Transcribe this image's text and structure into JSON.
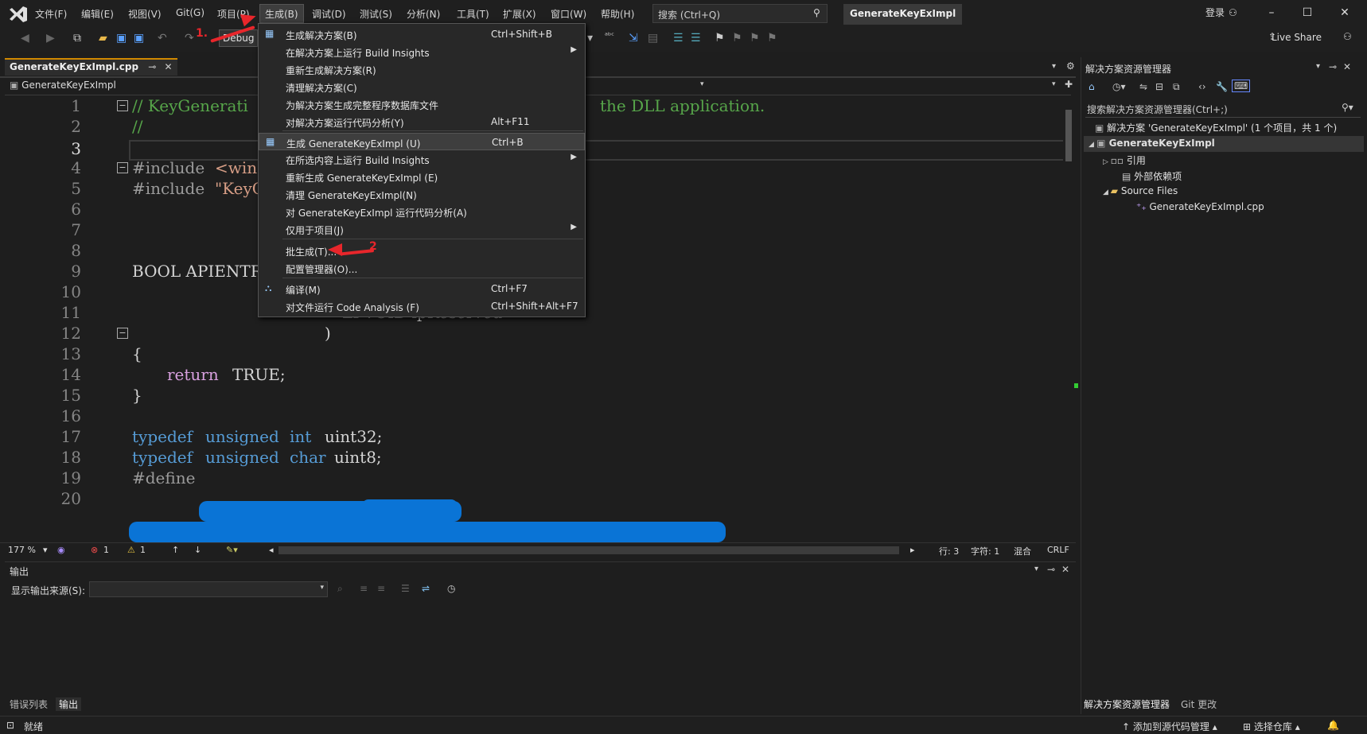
{
  "menubar": {
    "items": [
      "文件(F)",
      "编辑(E)",
      "视图(V)",
      "Git(G)",
      "项目(P)",
      "生成(B)",
      "调试(D)",
      "测试(S)",
      "分析(N)",
      "工具(T)",
      "扩展(X)",
      "窗口(W)",
      "帮助(H)"
    ],
    "search_placeholder": "搜索 (Ctrl+Q)",
    "project_badge": "GenerateKeyExImpl",
    "login": "登录"
  },
  "toolbar": {
    "config": "Debug",
    "live_share": "Live Share"
  },
  "editor": {
    "tab_label": "GenerateKeyExImpl.cpp",
    "nav_file": "GenerateKeyExImpl",
    "line_numbers": [
      "1",
      "2",
      "3",
      "4",
      "5",
      "6",
      "7",
      "8",
      "9",
      "10",
      "11",
      "12",
      "13",
      "14",
      "15",
      "16",
      "17",
      "18",
      "19",
      "20"
    ],
    "lines": {
      "l1a": "// KeyGenerati",
      "l1b": "the DLL application.",
      "l2": "//",
      "l4a": "#include",
      "l4b": "<wind",
      "l5a": "#include",
      "l5b": "\"KeyG",
      "l9": "BOOL APIENTRY",
      "l11": "LPVOID lpReserved",
      "l12": ")",
      "l13": "{",
      "l14a": "return",
      "l14b": "TRUE;",
      "l15": "}",
      "l17a": "typedef",
      "l17b": "unsigned",
      "l17c": "int",
      "l17d": "uint32;",
      "l18a": "typedef",
      "l18b": "unsigned",
      "l18c": "char",
      "l18d": "uint8;",
      "l19": "#define"
    }
  },
  "editor_status": {
    "zoom": "177 %",
    "errors": "1",
    "warnings": "1",
    "line": "行: 3",
    "char": "字符: 1",
    "mixed": "混合",
    "eol": "CRLF"
  },
  "output": {
    "title": "输出",
    "source_label": "显示输出来源(S):",
    "tabs": [
      "错误列表",
      "输出"
    ]
  },
  "solution_explorer": {
    "title": "解决方案资源管理器",
    "search": "搜索解决方案资源管理器(Ctrl+;)",
    "solution": "解决方案 'GenerateKeyExImpl' (1 个项目，共 1 个)",
    "project": "GenerateKeyExImpl",
    "references": "引用",
    "external_deps": "外部依赖项",
    "source_files": "Source Files",
    "cpp_file": "GenerateKeyExImpl.cpp",
    "bottom_tabs": [
      "解决方案资源管理器",
      "Git 更改"
    ]
  },
  "build_menu": {
    "items": [
      {
        "label": "生成解决方案(B)",
        "shortcut": "Ctrl+Shift+B"
      },
      {
        "label": "在解决方案上运行 Build Insights",
        "shortcut": ""
      },
      {
        "label": "重新生成解决方案(R)",
        "shortcut": ""
      },
      {
        "label": "清理解决方案(C)",
        "shortcut": ""
      },
      {
        "label": "为解决方案生成完整程序数据库文件",
        "shortcut": ""
      },
      {
        "label": "对解决方案运行代码分析(Y)",
        "shortcut": "Alt+F11"
      },
      {
        "label": "生成 GenerateKeyExImpl (U)",
        "shortcut": "Ctrl+B"
      },
      {
        "label": "在所选内容上运行 Build Insights",
        "shortcut": ""
      },
      {
        "label": "重新生成 GenerateKeyExImpl (E)",
        "shortcut": ""
      },
      {
        "label": "清理 GenerateKeyExImpl(N)",
        "shortcut": ""
      },
      {
        "label": "对 GenerateKeyExImpl 运行代码分析(A)",
        "shortcut": ""
      },
      {
        "label": "仅用于项目(J)",
        "shortcut": ""
      },
      {
        "label": "批生成(T)...",
        "shortcut": ""
      },
      {
        "label": "配置管理器(O)...",
        "shortcut": ""
      },
      {
        "label": "编译(M)",
        "shortcut": "Ctrl+F7"
      },
      {
        "label": "对文件运行 Code Analysis (F)",
        "shortcut": "Ctrl+Shift+Alt+F7"
      }
    ]
  },
  "annotations": {
    "a1": "1.",
    "a2": "2"
  },
  "statusbar": {
    "ready": "就绪",
    "add_source": "添加到源代码管理",
    "select_repo": "选择仓库"
  }
}
